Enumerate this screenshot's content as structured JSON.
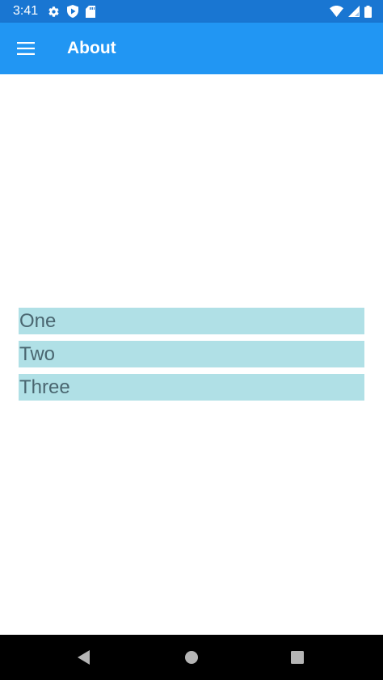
{
  "status_bar": {
    "time": "3:41",
    "left_icons": [
      "gear-icon",
      "play-protect-icon",
      "sd-card-icon"
    ],
    "right_icons": [
      "wifi-icon",
      "cell-signal-icon",
      "battery-icon"
    ]
  },
  "app_bar": {
    "menu_icon": "hamburger-menu-icon",
    "title": "About",
    "color": "#2196F3"
  },
  "list": {
    "item_color": "#B0E0E6",
    "items": [
      {
        "label": "One"
      },
      {
        "label": "Two"
      },
      {
        "label": "Three"
      }
    ]
  },
  "nav_bar": {
    "buttons": [
      "back-icon",
      "home-icon",
      "recents-icon"
    ]
  }
}
